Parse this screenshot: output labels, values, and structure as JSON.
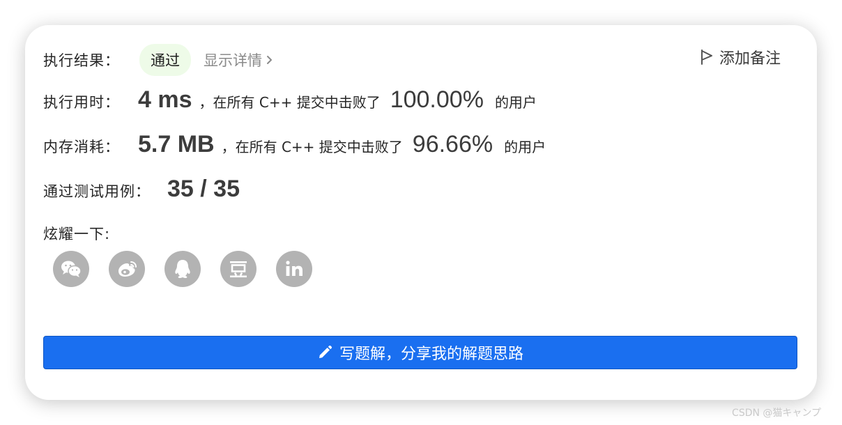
{
  "result": {
    "label": "执行结果：",
    "status": "通过",
    "detail_link": "显示详情",
    "add_note": "添加备注"
  },
  "runtime": {
    "label": "执行用时：",
    "value": "4 ms",
    "middle_text": "，在所有 C++ 提交中击败了",
    "percent": "100.00%",
    "suffix": "的用户"
  },
  "memory": {
    "label": "内存消耗：",
    "value": "5.7 MB",
    "middle_text": "，在所有 C++ 提交中击败了",
    "percent": "96.66%",
    "suffix": "的用户"
  },
  "tests": {
    "label": "通过测试用例：",
    "value": "35 / 35"
  },
  "share": {
    "label": "炫耀一下:",
    "buttons": [
      {
        "icon": "wechat-icon"
      },
      {
        "icon": "weibo-icon"
      },
      {
        "icon": "qq-icon"
      },
      {
        "icon": "douban-icon",
        "glyph": "豆"
      },
      {
        "icon": "linkedin-icon",
        "glyph": "in"
      }
    ]
  },
  "cta": {
    "label": "写题解，分享我的解题思路",
    "icon": "pencil-icon"
  },
  "watermark": "CSDN @猫キャンプ",
  "colors": {
    "accent": "#1a6ff0",
    "badge_bg": "#eefbe8",
    "share_icon_bg": "#b3b3b3"
  }
}
